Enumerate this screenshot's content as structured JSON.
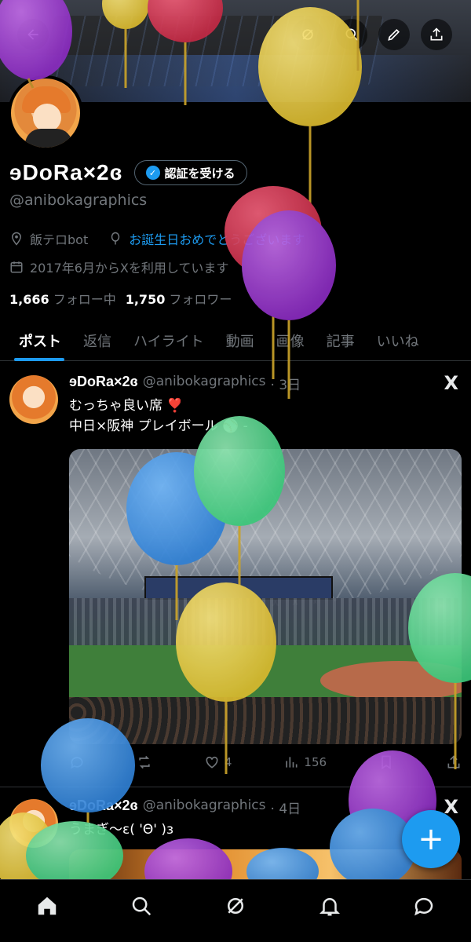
{
  "profile": {
    "display_name": "ɘDoRa×2ɞ",
    "verify_button": "認証を受ける",
    "handle": "@anibokagraphics",
    "location": "飯テロbot",
    "birthday_link": "お誕生日おめでとうございます",
    "joined": "2017年6月からXを利用しています",
    "following_count": "1,666",
    "following_label": "フォロー中",
    "followers_count": "1,750",
    "followers_label": "フォロワー"
  },
  "tabs": [
    {
      "label": "ポスト",
      "active": true
    },
    {
      "label": "返信"
    },
    {
      "label": "ハイライト"
    },
    {
      "label": "動画"
    },
    {
      "label": "画像"
    },
    {
      "label": "記事"
    },
    {
      "label": "いいね"
    }
  ],
  "posts": [
    {
      "name": "ɘDoRa×2ɞ",
      "handle": "@anibokagraphics",
      "time": "· 3日",
      "line1": "むっちゃ良い席 ❣️",
      "line2": "中日×阪神 プレイボール ⚾️ -",
      "likes": "4",
      "views": "156"
    },
    {
      "name": "ɘDoRa×2ɞ",
      "handle": "@anibokagraphics",
      "time": "· 4日",
      "line1": "うまぎ〜ɛ( 'Θ' )ɜ"
    }
  ],
  "icons": {
    "back": "back-arrow-icon",
    "grok": "grok-icon",
    "search": "search-icon",
    "edit": "pencil-icon",
    "share": "share-icon",
    "x_logo": "X"
  },
  "colors": {
    "accent": "#1d9bf0",
    "background": "#000000",
    "muted": "#71767b"
  }
}
